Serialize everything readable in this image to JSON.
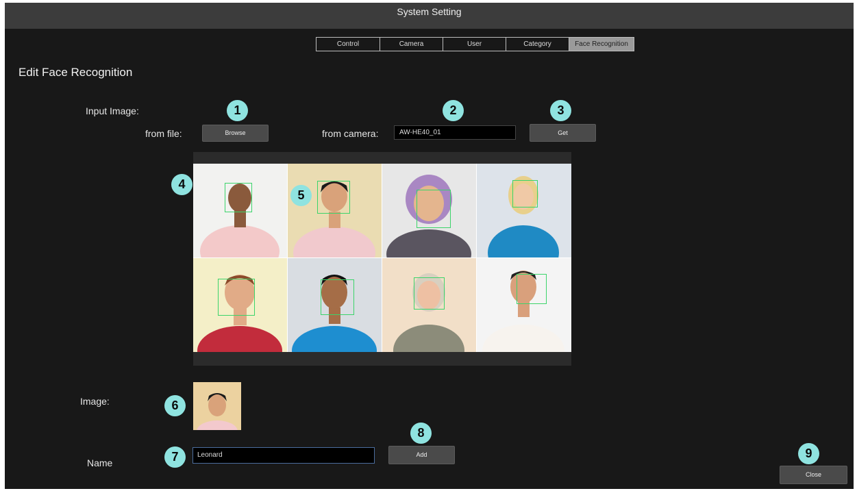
{
  "window": {
    "title": "System Setting"
  },
  "tabs": [
    {
      "label": "Control"
    },
    {
      "label": "Camera"
    },
    {
      "label": "User"
    },
    {
      "label": "Category"
    },
    {
      "label": "Face Recognition",
      "active": true
    }
  ],
  "section": {
    "title": "Edit Face Recognition"
  },
  "input_image": {
    "label": "Input Image:",
    "from_file_label": "from file:",
    "browse_label": "Browse",
    "from_camera_label": "from camera:",
    "camera_value": "AW-HE40_01",
    "get_label": "Get"
  },
  "detected_faces": {
    "count": 8,
    "box_color": "#3bd46a"
  },
  "image": {
    "label": "Image:"
  },
  "name": {
    "label": "Name",
    "value": "Leonard"
  },
  "buttons": {
    "add_label": "Add",
    "close_label": "Close"
  },
  "badges": [
    "1",
    "2",
    "3",
    "4",
    "5",
    "6",
    "7",
    "8",
    "9"
  ],
  "colors": {
    "badge": "#8fe3e0",
    "face_box": "#3bd46a",
    "background": "#181818",
    "titlebar": "#3c3c3c"
  }
}
